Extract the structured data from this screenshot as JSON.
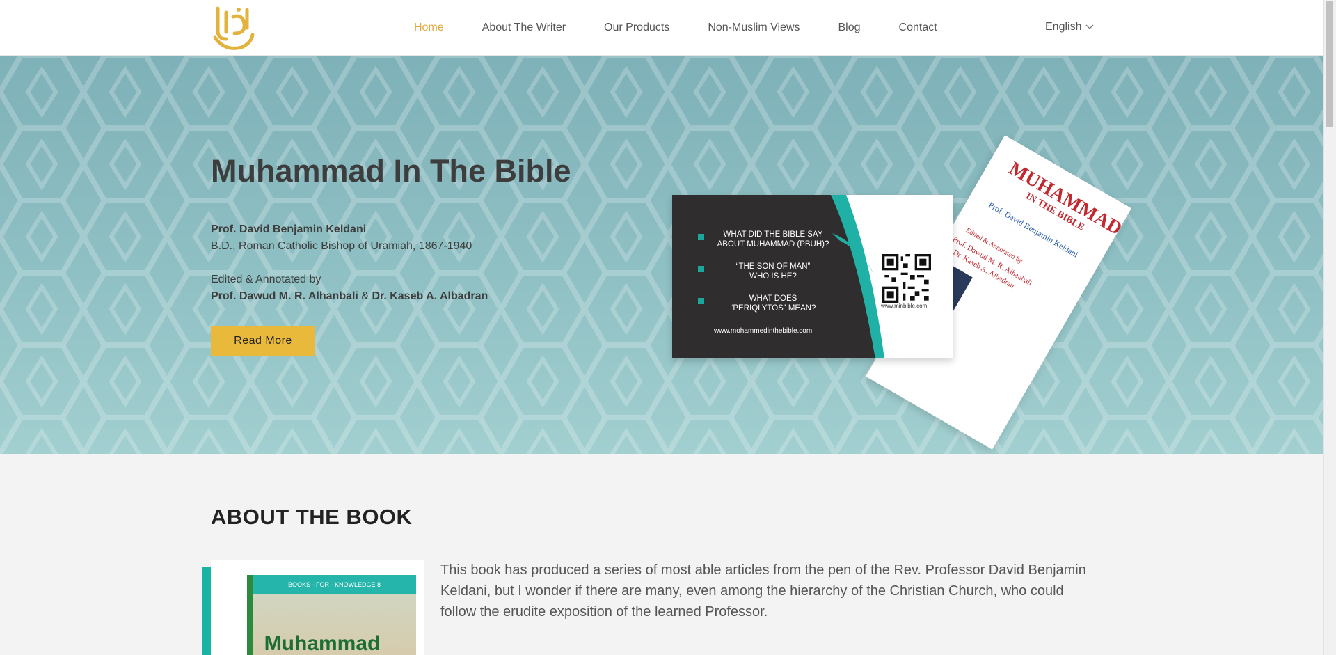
{
  "header": {
    "nav": [
      {
        "label": "Home",
        "active": true
      },
      {
        "label": "About The Writer",
        "active": false
      },
      {
        "label": "Our Products",
        "active": false
      },
      {
        "label": "Non-Muslim Views",
        "active": false
      },
      {
        "label": "Blog",
        "active": false
      },
      {
        "label": "Contact",
        "active": false
      }
    ],
    "language": "English"
  },
  "hero": {
    "title": "Muhammad In The Bible",
    "author_name": "Prof. David Benjamin Keldani",
    "author_desc": "B.D., Roman Catholic Bishop of Uramiah, 1867-1940",
    "edited_by": "Edited & Annotated by",
    "editor1": "Prof. Dawud M. R. Alhanbali",
    "amp": "&",
    "editor2": "Dr. Kaseb A. Albadran",
    "button": "Read More"
  },
  "flyer": {
    "title": "MUHAMMAD",
    "subtitle": "IN THE BIBLE",
    "author": "Prof. David Benjamin Keldani",
    "edited": "Edited & Annotated by",
    "editor1": "Prof. Dawud M. R. Alhanbali",
    "editor2": "Dr. Kaseb A. Albadran"
  },
  "card": {
    "q1_line1": "WHAT DID THE BIBLE SAY",
    "q1_line2": "ABOUT MUHAMMAD (PBUH)?",
    "q2_line1": "“THE SON OF MAN”",
    "q2_line2": "WHO IS HE?",
    "q3_line1": "WHAT DOES",
    "q3_line2": "“PERIQLYTOS” MEAN?",
    "url": "www.mohammedinthebible.com",
    "qr_url": "www.minbible.com"
  },
  "about": {
    "title": "ABOUT THE BOOK",
    "text": "This book has produced a series of most able articles from the pen of the Rev. Professor David Benjamin Keldani, but I wonder if there are many, even among the hierarchy of the Christian Church, who could follow the erudite exposition of the learned Professor.",
    "book_band": "BOOKS - FOR - KNOWLEDGE 8",
    "book_title": "Muhammad"
  },
  "colors": {
    "accent": "#e9b93c",
    "nav_active": "#e0a93a",
    "teal": "#17b3a3",
    "hero_bg": "#8fc0c4"
  }
}
